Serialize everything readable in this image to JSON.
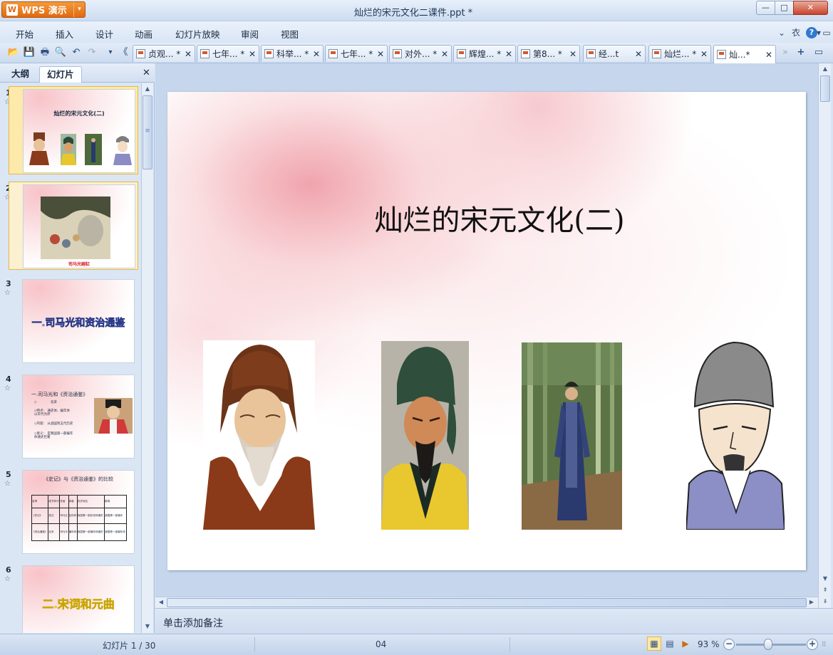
{
  "titlebar": {
    "app_button": "WPS 演示",
    "app_logo": "W",
    "app_drop": "▾",
    "window_title": "灿烂的宋元文化二课件.ppt *",
    "minimize": "—",
    "maximize": "□",
    "close": "✕"
  },
  "menu": {
    "items": [
      "开始",
      "插入",
      "设计",
      "动画",
      "幻灯片放映",
      "审阅",
      "视图"
    ],
    "collapse_icon": "⌄",
    "skin_icon": "衣",
    "help_icon": "?",
    "help_drop": "▾",
    "restore_icon": "▭"
  },
  "toolbar": {
    "icons": [
      "📂",
      "💾",
      "🖶",
      "🔍",
      "↶",
      "↷",
      "▾",
      "《"
    ],
    "tab_more": "»",
    "new_tab": "+",
    "tab_list": "▭"
  },
  "tabs": [
    {
      "label": "贞观... *",
      "close": "✕"
    },
    {
      "label": "七年... *",
      "close": "✕"
    },
    {
      "label": "科举... *",
      "close": "✕"
    },
    {
      "label": "七年... *",
      "close": "✕"
    },
    {
      "label": "对外... *",
      "close": "✕"
    },
    {
      "label": "辉煌... *",
      "close": "✕"
    },
    {
      "label": "第8... *",
      "close": "✕"
    },
    {
      "label": "经...t",
      "close": "✕"
    },
    {
      "label": "灿烂... *",
      "close": "✕"
    },
    {
      "label": "灿...*",
      "close": "✕"
    }
  ],
  "left_panel": {
    "tab_outline": "大纲",
    "tab_slides": "幻灯片",
    "close": "✕",
    "thumbnails": [
      {
        "num": "1",
        "star": "☆",
        "title": "灿烂的宋元文化(二)"
      },
      {
        "num": "2",
        "star": "☆",
        "caption": "司马光砸缸"
      },
      {
        "num": "3",
        "star": "☆",
        "title": "一.司马光和资治通鉴"
      },
      {
        "num": "4",
        "star": "☆",
        "title": "一.司马光和《资治通鉴》",
        "bullets": [
          "◇",
          "◇特点：",
          "◇内容：",
          "◇意义："
        ],
        "bullet_texts": [
          "北宋",
          "通史体、编年体\n以年代为序",
          "从战国到五代历史",
          "是我国第一部编年\n体通史巨著"
        ]
      },
      {
        "num": "5",
        "star": "☆",
        "title": "《史记》与《资治通鉴》的比较",
        "table": [
          [
            "名称",
            "成书年代",
            "作者",
            "体裁",
            "历史地位",
            "影响"
          ],
          [
            "《史记》",
            "西汉",
            "司马迁",
            "纪传体",
            "我国第一部纪传体通史",
            "我国第一部通史"
          ],
          [
            "《资治通鉴》",
            "北宋",
            "司马光",
            "编年体",
            "我国第一部编年体通史",
            "我国第一部编年体"
          ]
        ]
      },
      {
        "num": "6",
        "star": "☆",
        "title": "二.宋词和元曲"
      }
    ]
  },
  "slide": {
    "title": "灿烂的宋元文化(二)"
  },
  "scroll": {
    "up": "▲",
    "down": "▼",
    "left": "◀",
    "right": "▶",
    "grip": "≡",
    "prev": "⇞",
    "next": "⇟"
  },
  "notes": {
    "placeholder": "单击添加备注"
  },
  "status": {
    "slide_counter": "幻灯片 1 / 30",
    "design_name": "04",
    "view_icons": [
      "▦",
      "▤",
      "▶"
    ],
    "zoom_level": "93 %",
    "zoom_minus": "−",
    "zoom_plus": "+",
    "resize_grip": "⠿"
  }
}
